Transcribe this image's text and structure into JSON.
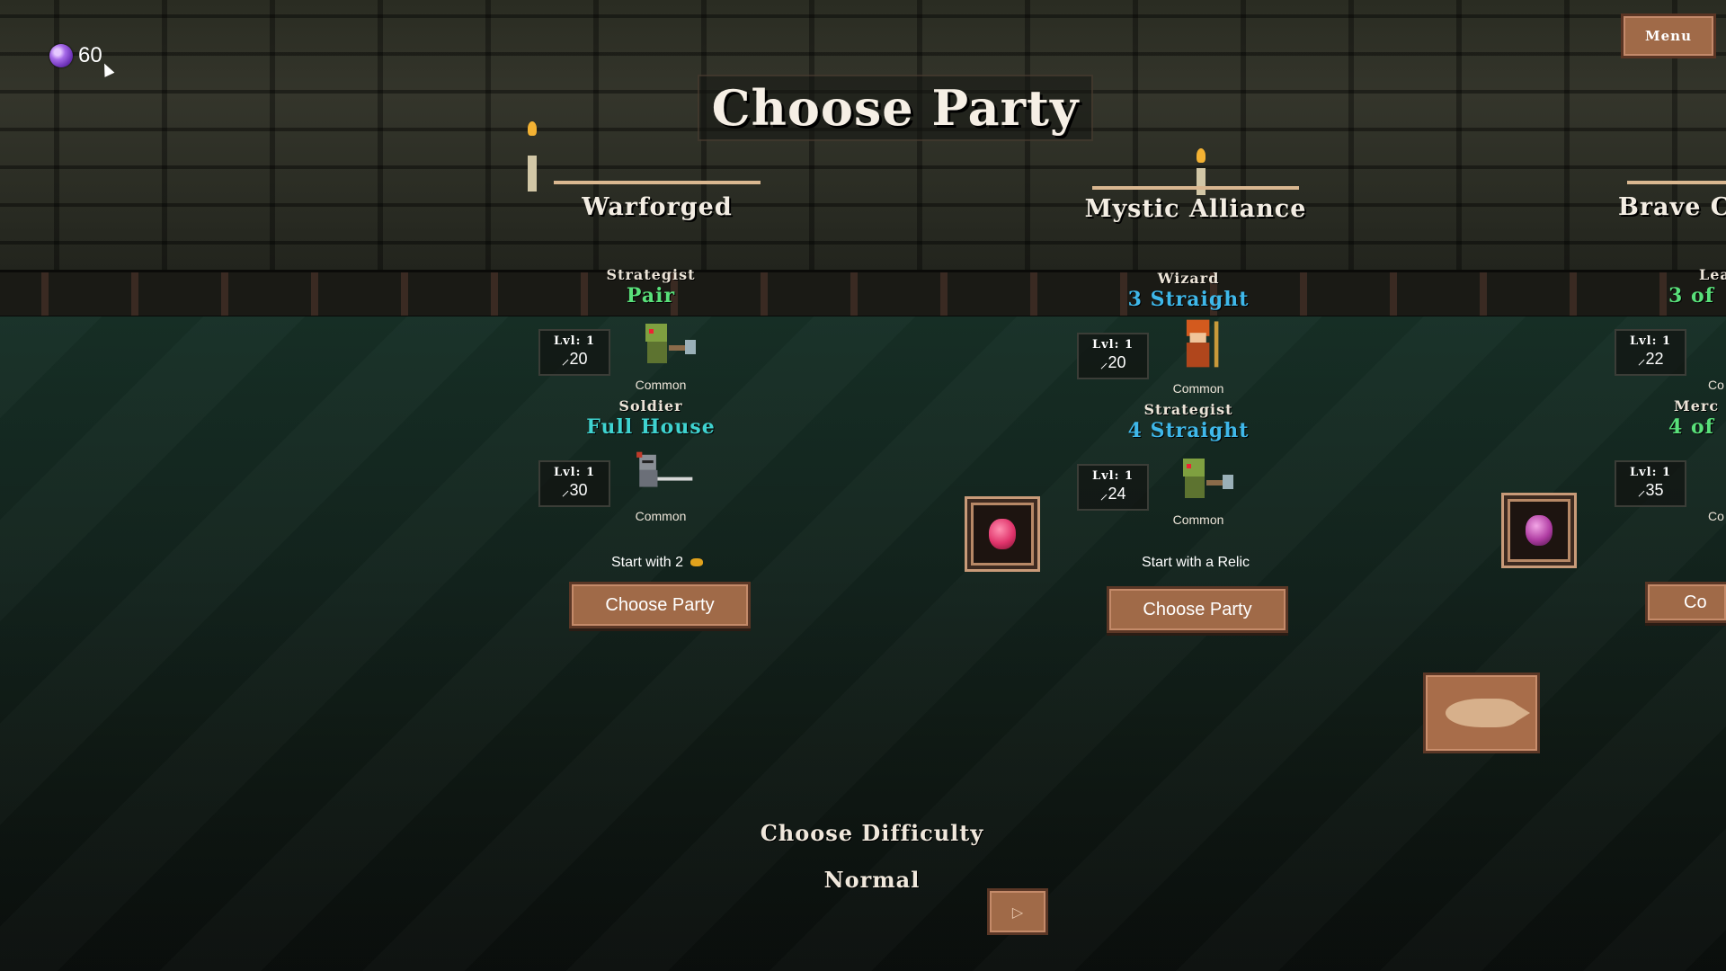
{
  "currency": {
    "value": "60",
    "icon": "purple-gem-icon"
  },
  "menu": {
    "label": "Menu"
  },
  "title": "Choose Party",
  "parties": [
    {
      "name": "Warforged",
      "heroes": [
        {
          "role": "Strategist",
          "hand": "Pair",
          "hand_color": "#59e07a",
          "level": "Lvl: 1",
          "attack": "20",
          "rarity": "Common"
        },
        {
          "role": "Soldier",
          "hand": "Full House",
          "hand_color": "#3fd3d0",
          "level": "Lvl: 1",
          "attack": "30",
          "rarity": "Common"
        }
      ],
      "perk": "Start with 2",
      "button": "Choose Party"
    },
    {
      "name": "Mystic Alliance",
      "heroes": [
        {
          "role": "Wizard",
          "hand": "3 Straight",
          "hand_color": "#3fb8ea",
          "level": "Lvl: 1",
          "attack": "20",
          "rarity": "Common"
        },
        {
          "role": "Strategist",
          "hand": "4 Straight",
          "hand_color": "#3fb8ea",
          "level": "Lvl: 1",
          "attack": "24",
          "rarity": "Common"
        }
      ],
      "perk": "Start with a Relic",
      "button": "Choose Party"
    },
    {
      "name": "Brave Co",
      "heroes": [
        {
          "role": "Lea",
          "hand": "3 of",
          "hand_color": "#59e07a",
          "level": "Lvl: 1",
          "attack": "22",
          "rarity": "Co"
        },
        {
          "role": "Merc",
          "hand": "4 of",
          "hand_color": "#59e07a",
          "level": "Lvl: 1",
          "attack": "35",
          "rarity": "Co"
        }
      ],
      "button": "Co"
    }
  ],
  "relics": [
    {
      "icon": "berry-relic-icon",
      "color": "#e0336b"
    },
    {
      "icon": "orb-relic-icon",
      "color": "#b03da3"
    }
  ],
  "difficulty": {
    "label": "Choose Difficulty",
    "value": "Normal"
  },
  "colors": {
    "button": "#a06a48",
    "button_border": "#5b3726"
  }
}
